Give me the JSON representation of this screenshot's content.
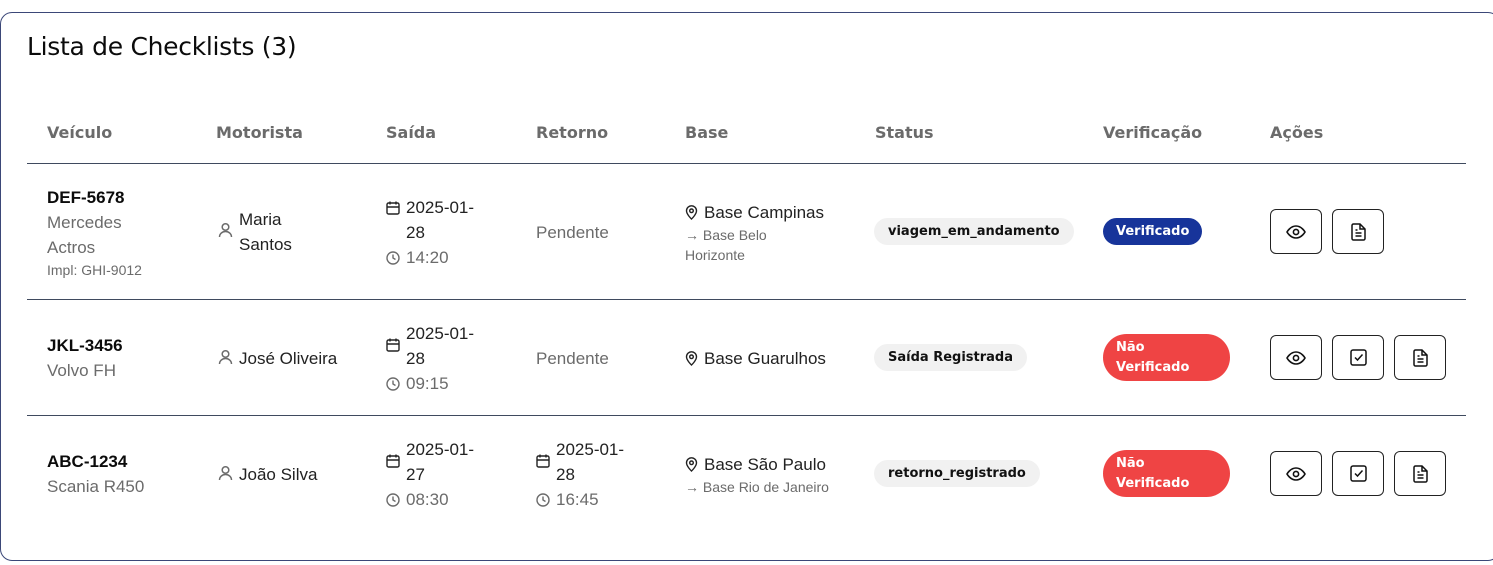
{
  "title": "Lista de Checklists (3)",
  "columns": [
    "Veículo",
    "Motorista",
    "Saída",
    "Retorno",
    "Base",
    "Status",
    "Verificação",
    "Ações"
  ],
  "rows": [
    {
      "plate": "DEF-5678",
      "model_line1": "Mercedes",
      "model_line2": "Actros",
      "impl": "Impl: GHI-9012",
      "driver_line1": "Maria",
      "driver_line2": "Santos",
      "saida_date_line1": "2025-01-",
      "saida_date_line2": "28",
      "saida_time": "14:20",
      "retorno": "Pendente",
      "base": "Base Campinas",
      "base_dest_line1": "→ Base Belo",
      "base_dest_line2": "Horizonte",
      "status": "viagem_em_andamento",
      "verificacao": "Verificado"
    },
    {
      "plate": "JKL-3456",
      "model_line1": "Volvo FH",
      "driver_line1": "José Oliveira",
      "saida_date_line1": "2025-01-",
      "saida_date_line2": "28",
      "saida_time": "09:15",
      "retorno": "Pendente",
      "base": "Base Guarulhos",
      "status": "Saída Registrada",
      "verificacao_line1": "Não",
      "verificacao_line2": "Verificado"
    },
    {
      "plate": "ABC-1234",
      "model_line1": "Scania R450",
      "driver_line1": "João Silva",
      "saida_date_line1": "2025-01-",
      "saida_date_line2": "27",
      "saida_time": "08:30",
      "retorno_date_line1": "2025-01-",
      "retorno_date_line2": "28",
      "retorno_time": "16:45",
      "base": "Base São Paulo",
      "base_dest_line1": "→ Base Rio de Janeiro",
      "status": "retorno_registrado",
      "verificacao_line1": "Não",
      "verificacao_line2": "Verificado"
    }
  ],
  "icons": {
    "driver": "user-icon",
    "date": "calendar-icon",
    "time": "clock-icon",
    "base": "map-pin-icon",
    "view": "eye-icon",
    "verify": "check-square-icon",
    "report": "file-text-icon"
  },
  "colors": {
    "verified": "#17349a",
    "not_verified": "#ef4444",
    "status_pill": "#f1f1f1"
  }
}
